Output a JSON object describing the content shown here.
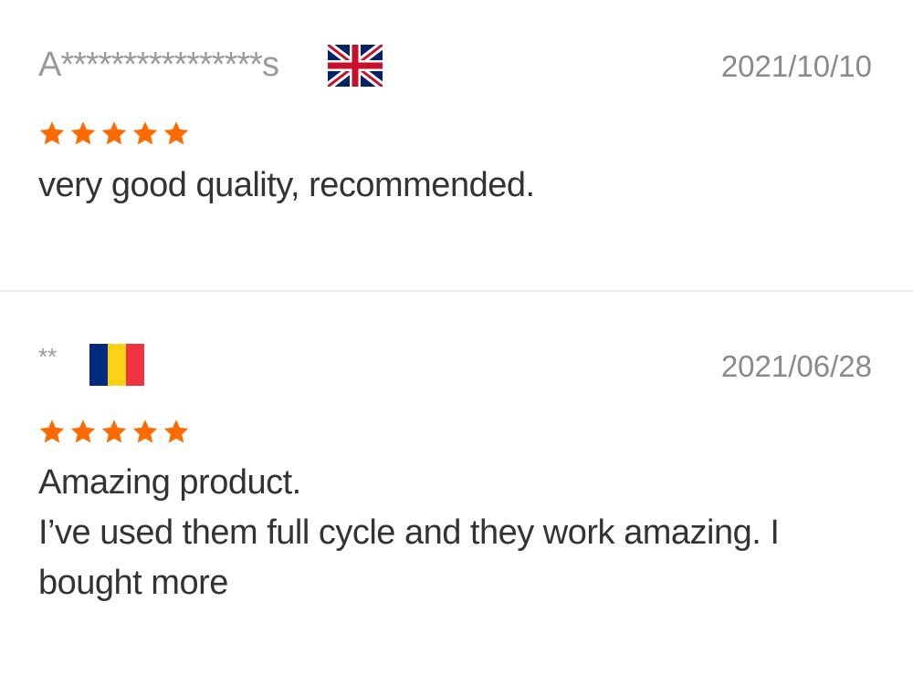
{
  "reviews": [
    {
      "reviewer": "A****************s",
      "country_flag": "uk-flag-icon",
      "date": "2021/10/10",
      "rating": 5,
      "text": [
        "very good quality, recommended."
      ]
    },
    {
      "reviewer": "**",
      "country_flag": "romania-flag-icon",
      "date": "2021/06/28",
      "rating": 5,
      "text": [
        "Amazing product.",
        "I’ve used them full cycle and they work amazing. I bought more"
      ]
    }
  ],
  "colors": {
    "star": "#ff6a00",
    "reviewer": "#9a9a9a",
    "date": "#8a8a8a",
    "text": "#333333",
    "divider": "#eeeeee"
  }
}
